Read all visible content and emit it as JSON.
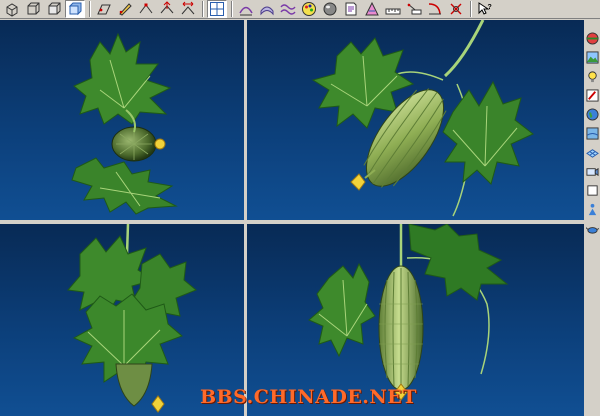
{
  "toolbar": {
    "icons": [
      "perspective-cube-icon",
      "wireframe-cube-icon",
      "hidden-line-cube-icon",
      "shaded-cube-icon",
      "plane-tool-icon",
      "pen-tool-icon",
      "node-tool-icon",
      "move-node-icon",
      "scale-node-icon",
      "grid-view-icon",
      "edit-curve-icon",
      "edit-surface-icon",
      "wave-deform-icon",
      "color-palette-icon",
      "material-sphere-icon",
      "sheet-icon",
      "gradient-icon",
      "ruler-icon",
      "measure-icon",
      "bend-tool-icon",
      "twist-tool-icon",
      "help-cursor-icon"
    ],
    "active": "shaded-cube-icon"
  },
  "right_toolbar": {
    "icons": [
      "sphere-render-icon",
      "landscape-icon",
      "light-bulb-icon",
      "edit-object-icon",
      "globe-icon",
      "texture-icon",
      "mesh-icon",
      "camera-icon",
      "blank-square-icon",
      "figure-icon",
      "teapot-icon"
    ]
  },
  "viewports": {
    "top_left": "top-view",
    "top_right": "perspective-view",
    "bottom_left": "front-view",
    "bottom_right": "side-view"
  },
  "watermark": "BBS.CHINADE.NET"
}
